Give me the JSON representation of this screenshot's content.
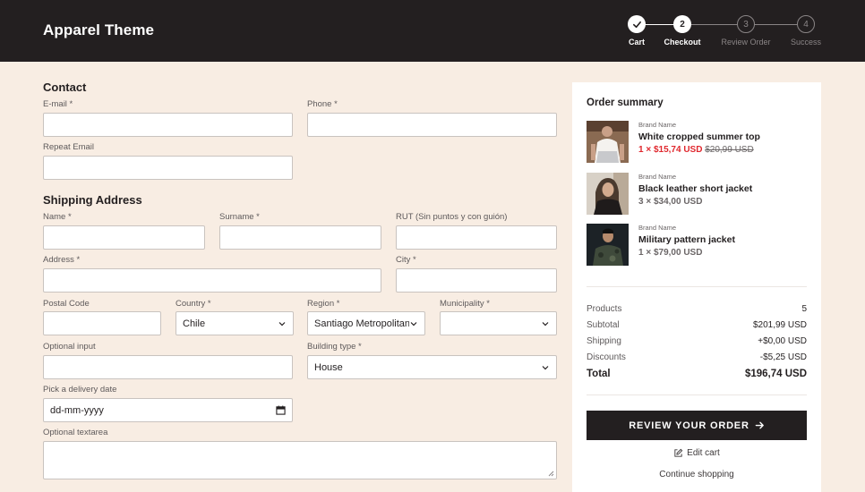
{
  "brand": "Apparel Theme",
  "stepper": {
    "steps": [
      {
        "number": "",
        "label": "Cart",
        "state": "done"
      },
      {
        "number": "2",
        "label": "Checkout",
        "state": "active"
      },
      {
        "number": "3",
        "label": "Review Order",
        "state": "inactive"
      },
      {
        "number": "4",
        "label": "Success",
        "state": "inactive"
      }
    ]
  },
  "contact": {
    "title": "Contact",
    "email_label": "E-mail *",
    "phone_label": "Phone *",
    "repeat_email_label": "Repeat Email"
  },
  "shipping": {
    "title": "Shipping Address",
    "name_label": "Name *",
    "surname_label": "Surname *",
    "rut_label": "RUT (Sin puntos y con guión)",
    "address_label": "Address *",
    "city_label": "City *",
    "postal_label": "Postal Code",
    "country_label": "Country *",
    "country_value": "Chile",
    "region_label": "Region *",
    "region_value": "Santiago Metropolitana",
    "municipality_label": "Municipality *",
    "municipality_value": "",
    "optional_input_label": "Optional input",
    "building_label": "Building type *",
    "building_value": "House",
    "date_label": "Pick a delivery date",
    "date_placeholder": "dd-mm-yyyy",
    "textarea_label": "Optional textarea"
  },
  "summary": {
    "title": "Order summary",
    "items": [
      {
        "brand": "Brand Name",
        "name": "White cropped summer top",
        "price": "1 × $15,74 USD",
        "original_price": "$20,99 USD",
        "on_sale": true
      },
      {
        "brand": "Brand Name",
        "name": "Black leather short jacket",
        "price": "3 × $34,00 USD",
        "original_price": "",
        "on_sale": false
      },
      {
        "brand": "Brand Name",
        "name": "Military pattern jacket",
        "price": "1 × $79,00 USD",
        "original_price": "",
        "on_sale": false
      }
    ],
    "rows": {
      "products_label": "Products",
      "products_value": "5",
      "subtotal_label": "Subtotal",
      "subtotal_value": "$201,99 USD",
      "shipping_label": "Shipping",
      "shipping_value": "+$0,00 USD",
      "discounts_label": "Discounts",
      "discounts_value": "-$5,25 USD",
      "total_label": "Total",
      "total_value": "$196,74 USD"
    },
    "cta_label": "REVIEW YOUR ORDER",
    "edit_cart_label": "Edit cart",
    "continue_label": "Continue shopping"
  },
  "colors": {
    "header_bg": "#231f20",
    "page_bg": "#f8ede3",
    "sale_red": "#e0282e"
  }
}
